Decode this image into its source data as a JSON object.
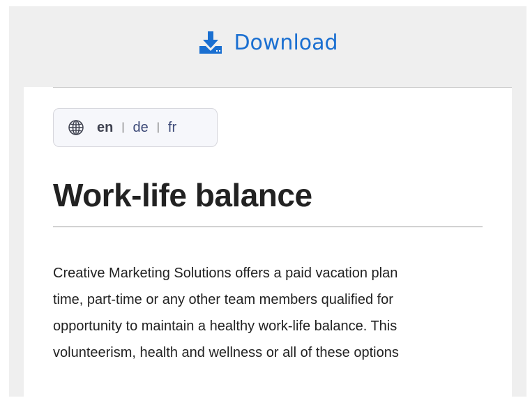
{
  "download": {
    "label": "Download",
    "icon": "download-icon",
    "color": "#1a6fd1"
  },
  "language_switcher": {
    "icon": "globe-icon",
    "languages": [
      {
        "code": "en",
        "current": true
      },
      {
        "code": "de",
        "current": false
      },
      {
        "code": "fr",
        "current": false
      }
    ],
    "separator": "|"
  },
  "article": {
    "title": "Work-life balance",
    "lines": [
      "Creative Marketing Solutions offers a paid vacation plan",
      "time, part-time or any other team members qualified for",
      "opportunity to maintain a healthy work-life balance. This",
      "volunteerism, health and wellness or all of these options"
    ]
  }
}
